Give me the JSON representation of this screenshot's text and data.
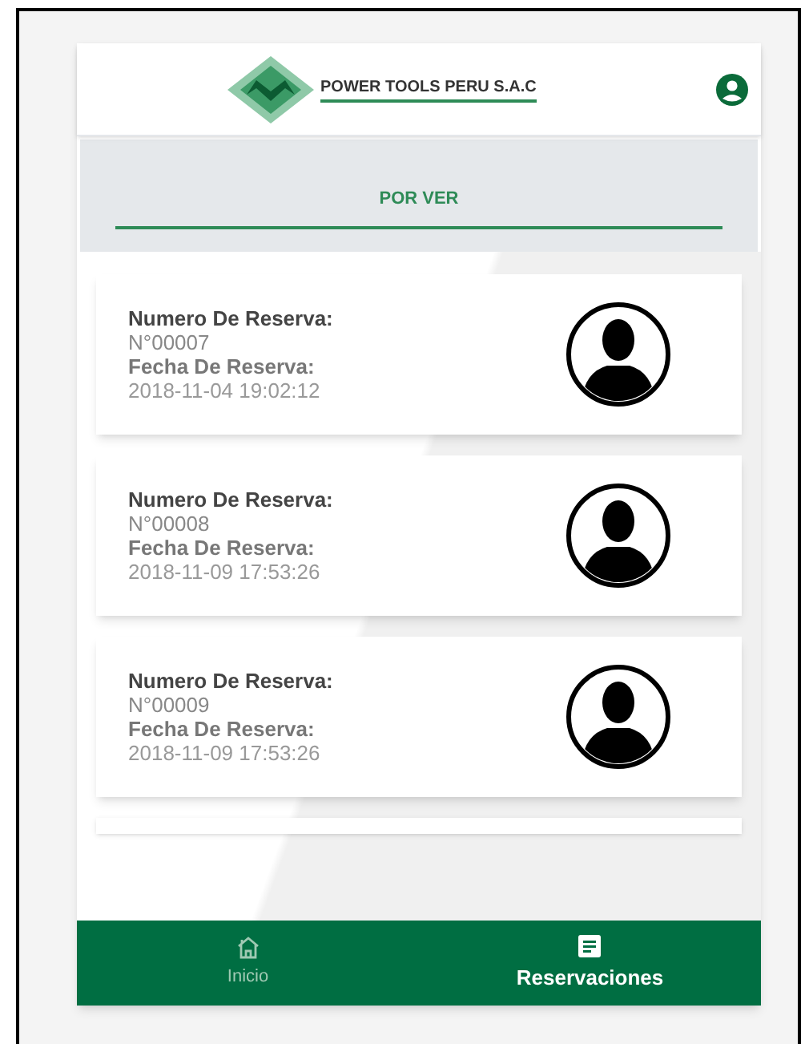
{
  "header": {
    "logo_text": "POWER TOOLS PERU S.A.C"
  },
  "tabs": [
    {
      "label": "POR VER",
      "selected": true
    }
  ],
  "reservations": [
    {
      "number_label": "Numero De Reserva:",
      "number": "N°00007",
      "date_label": "Fecha De Reserva:",
      "date": "2018-11-04 19:02:12"
    },
    {
      "number_label": "Numero De Reserva:",
      "number": "N°00008",
      "date_label": "Fecha De Reserva:",
      "date": "2018-11-09 17:53:26"
    },
    {
      "number_label": "Numero De Reserva:",
      "number": "N°00009",
      "date_label": "Fecha De Reserva:",
      "date": "2018-11-09 17:53:26"
    }
  ],
  "bottom_nav": [
    {
      "kind": "home",
      "label": "Inicio",
      "selected": false
    },
    {
      "kind": "list",
      "label": "Reservaciones",
      "selected": true
    }
  ]
}
